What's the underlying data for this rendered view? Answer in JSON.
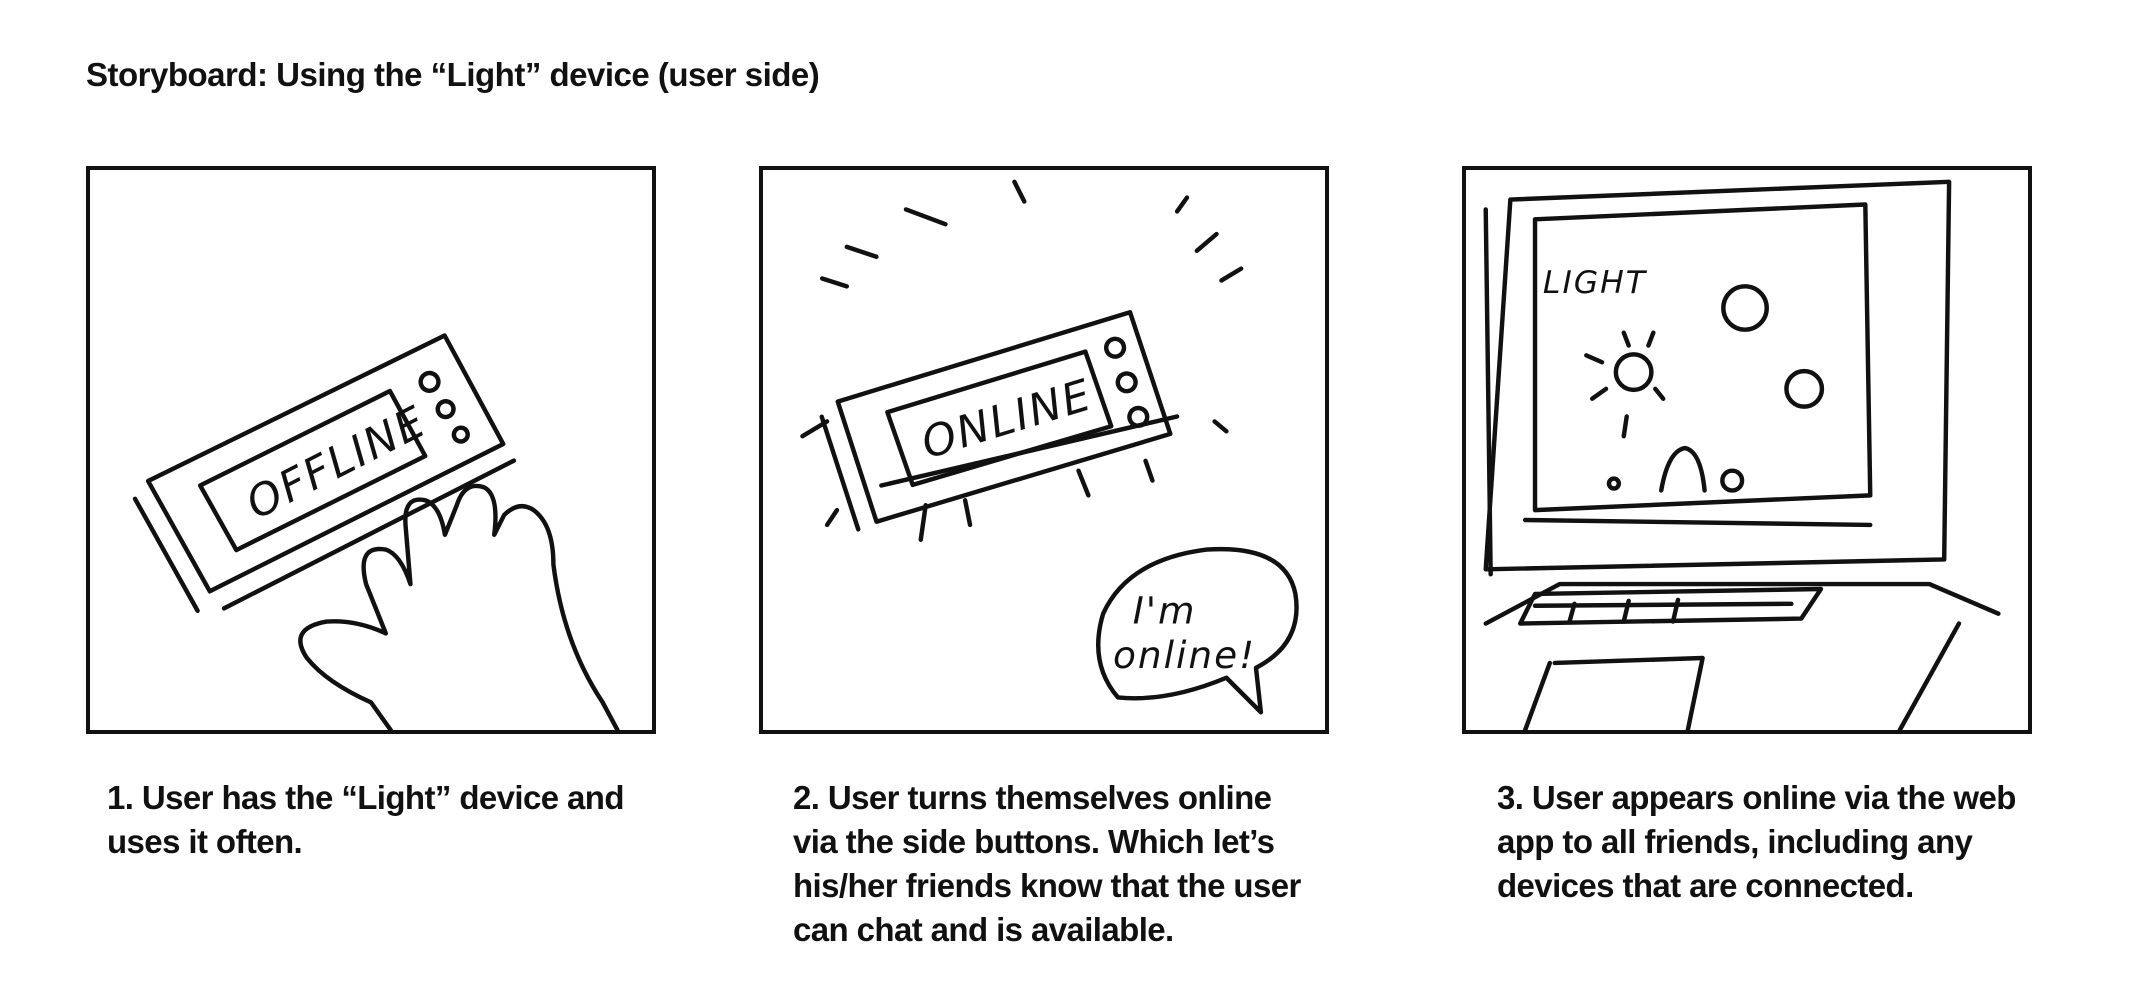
{
  "title": "Storyboard: Using the “Light” device (user side)",
  "panels": [
    {
      "screen_text": "OFFLINE",
      "caption": "1. User has the “Light” device and uses it often."
    },
    {
      "screen_text": "ONLINE",
      "speech_bubble": "I'm online!",
      "speech_line_1": "I'm",
      "speech_line_2": "online!",
      "caption": "2. User turns themselves online via the side buttons. Which let’s his/her friends know that the user can chat and is available."
    },
    {
      "screen_text": "LIGHT",
      "caption": "3. User appears online via the web app to all friends, including any devices that are connected."
    }
  ]
}
